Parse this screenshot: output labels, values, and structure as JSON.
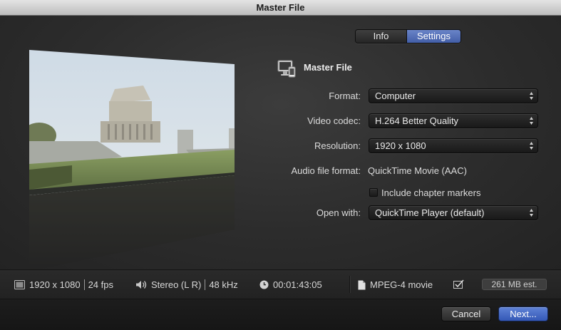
{
  "window": {
    "title": "Master File"
  },
  "tabs": [
    {
      "label": "Info",
      "selected": false
    },
    {
      "label": "Settings",
      "selected": true
    }
  ],
  "section": {
    "title": "Master File",
    "icon": "computer-icon"
  },
  "settings": {
    "format": {
      "label": "Format:",
      "value": "Computer"
    },
    "video_codec": {
      "label": "Video codec:",
      "value": "H.264 Better Quality"
    },
    "resolution": {
      "label": "Resolution:",
      "value": "1920 x 1080"
    },
    "audio_file_format": {
      "label": "Audio file format:",
      "value": "QuickTime Movie (AAC)"
    },
    "chapter_markers": {
      "label": "Include chapter markers",
      "checked": false
    },
    "open_with": {
      "label": "Open with:",
      "value": "QuickTime Player (default)"
    }
  },
  "status": {
    "resolution": "1920 x 1080",
    "fps": "24 fps",
    "audio_channels": "Stereo (L R)",
    "sample_rate": "48 kHz",
    "duration": "00:01:43:05",
    "file_type": "MPEG-4 movie",
    "size_estimate": "261 MB est."
  },
  "buttons": {
    "cancel": "Cancel",
    "next": "Next..."
  },
  "colors": {
    "accent": "#4a6fc6",
    "background": "#2c2c2c",
    "titlebar": "#d4d4d4"
  }
}
